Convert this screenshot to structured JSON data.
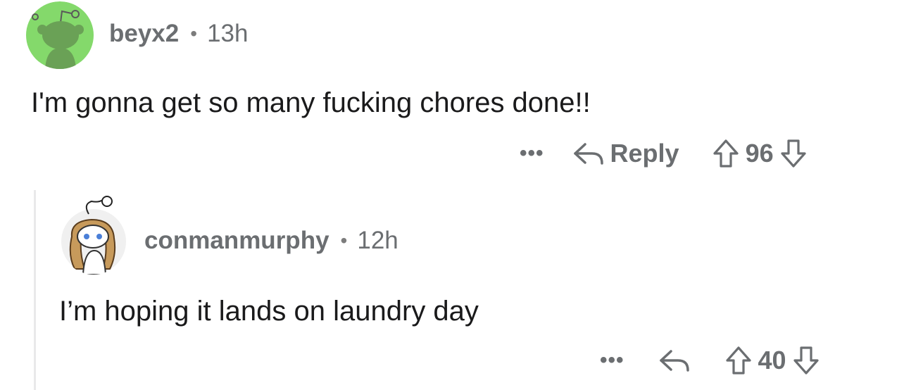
{
  "comments": [
    {
      "username": "beyx2",
      "separator": "•",
      "time": "13h",
      "avatar_icon": "snoo-avatar-icon",
      "avatar_bg": "#84d96b",
      "text": "I'm gonna get so many fucking chores done!!",
      "actions": {
        "more": "•••",
        "reply_label": "Reply",
        "score": "96"
      }
    },
    {
      "username": "conmanmurphy",
      "separator": "•",
      "time": "12h",
      "avatar_icon": "snoo-avatar-icon",
      "avatar_bg": "#f0f0f0",
      "text": "I’m hoping it lands on laundry day",
      "actions": {
        "more": "•••",
        "score": "40"
      }
    }
  ],
  "colors": {
    "meta_text": "#6b6e71",
    "body_text": "#1a1a1b",
    "thread_line": "#e9e9ea"
  }
}
